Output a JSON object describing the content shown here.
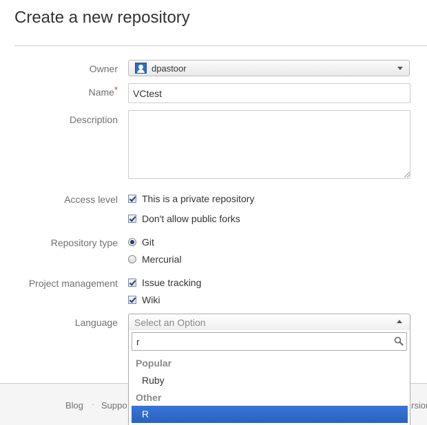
{
  "page": {
    "title": "Create a new repository"
  },
  "form": {
    "owner": {
      "label": "Owner",
      "value": "dpastoor"
    },
    "name": {
      "label": "Name",
      "required_mark": "*",
      "value": "VCtest"
    },
    "description": {
      "label": "Description",
      "value": ""
    },
    "access_level": {
      "label": "Access level",
      "options": [
        {
          "label": "This is a private repository",
          "checked": true
        },
        {
          "label": "Don't allow public forks",
          "checked": true
        }
      ]
    },
    "repository_type": {
      "label": "Repository type",
      "options": [
        {
          "label": "Git",
          "selected": true
        },
        {
          "label": "Mercurial",
          "selected": false
        }
      ]
    },
    "project_management": {
      "label": "Project management",
      "options": [
        {
          "label": "Issue tracking",
          "checked": true
        },
        {
          "label": "Wiki",
          "checked": true
        }
      ]
    },
    "language": {
      "label": "Language",
      "placeholder": "Select an Option",
      "search_value": "r",
      "groups": [
        {
          "label": "Popular",
          "items": [
            "Ruby"
          ]
        },
        {
          "label": "Other",
          "items": [
            "R"
          ]
        }
      ],
      "highlighted": "R"
    }
  },
  "footer": {
    "links": [
      "Blog",
      "Suppo",
      "rsion"
    ],
    "separator": "·"
  },
  "colors": {
    "selected_item_bg": "#3875d7",
    "required_mark": "#d04437",
    "owner_avatar": "#2e6ec0"
  }
}
